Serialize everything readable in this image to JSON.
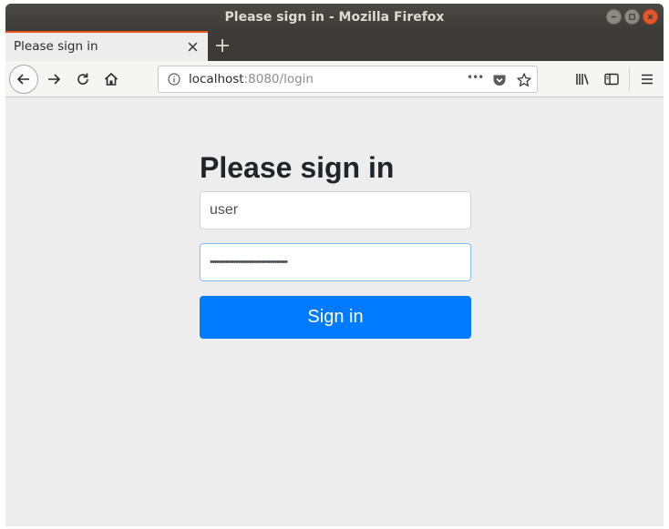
{
  "window": {
    "title": "Please sign in - Mozilla Firefox"
  },
  "tabs": [
    {
      "label": "Please sign in",
      "active": true
    }
  ],
  "urlbar": {
    "host": "localhost",
    "rest": ":8080/login",
    "more_label": "•••"
  },
  "page": {
    "heading": "Please sign in",
    "username": {
      "value": "user"
    },
    "password": {
      "masked_value": "••••••••••••••••••••••••••••••••••••"
    },
    "submit_label": "Sign in"
  },
  "colors": {
    "accent_tab": "#e95420",
    "button": "#007bff",
    "close_window": "#e2572c"
  },
  "icons": [
    "minimize-icon",
    "maximize-icon",
    "close-icon",
    "tab-close-icon",
    "new-tab-icon",
    "back-icon",
    "forward-icon",
    "reload-icon",
    "home-icon",
    "info-icon",
    "pocket-icon",
    "bookmark-star-icon",
    "library-icon",
    "sidebar-icon",
    "menu-icon"
  ]
}
